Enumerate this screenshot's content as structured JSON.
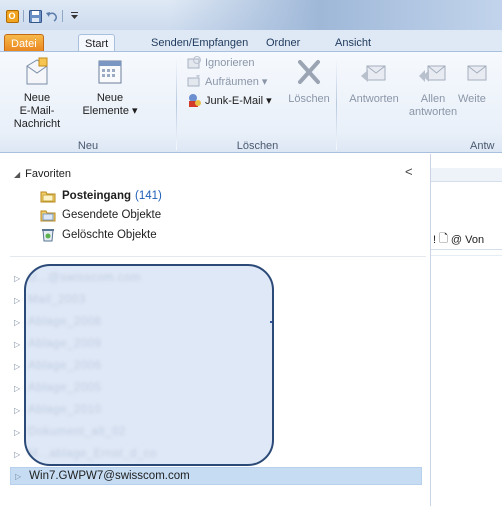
{
  "quick_access": {
    "app_icon_letter": "O",
    "items": [
      "save-icon",
      "undo-icon",
      "customize-icon"
    ]
  },
  "tabs": [
    {
      "label": "Datei",
      "type": "file"
    },
    {
      "label": "Start",
      "type": "active"
    },
    {
      "label": "Senden/Empfangen",
      "type": "normal"
    },
    {
      "label": "Ordner",
      "type": "normal"
    },
    {
      "label": "Ansicht",
      "type": "normal"
    }
  ],
  "ribbon": {
    "neu": {
      "group_label": "Neu",
      "new_email_label": "Neue\nE-Mail-Nachricht",
      "new_items_label": "Neue\nElemente ▾"
    },
    "loeschen": {
      "group_label": "Löschen",
      "ignore_label": "Ignorieren",
      "cleanup_label": "Aufräumen ▾",
      "junk_label": "Junk-E-Mail ▾",
      "delete_label": "Löschen"
    },
    "antworten": {
      "group_label": "Antw",
      "reply_label": "Antworten",
      "reply_all_label": "Allen\nantworten",
      "forward_label": "Weite"
    }
  },
  "navigation": {
    "favorites_header": "Favoriten",
    "collapse_glyph": "<",
    "favorites": [
      {
        "label": "Posteingang",
        "count": "(141)",
        "bold": true,
        "icon": "inbox-icon"
      },
      {
        "label": "Gesendete Objekte",
        "count": "",
        "bold": false,
        "icon": "sent-items-icon"
      },
      {
        "label": "Gelöschte Objekte",
        "count": "",
        "bold": false,
        "icon": "deleted-items-icon"
      }
    ],
    "accounts": [
      {
        "label": "U...@swisscom.com",
        "obscured": true
      },
      {
        "label": "Mail_2003",
        "obscured": true
      },
      {
        "label": "Ablage_2008",
        "obscured": true
      },
      {
        "label": "Ablage_2009",
        "obscured": true
      },
      {
        "label": "Ablage_2006",
        "obscured": true
      },
      {
        "label": "Ablage_2005",
        "obscured": true
      },
      {
        "label": "Ablage_2010",
        "obscured": true
      },
      {
        "label": "Dokument_alt_02",
        "obscured": true
      },
      {
        "label": "M...ablage_Ernst_d_co",
        "obscured": true
      },
      {
        "label": "Win7.GWPW7@swisscom.com",
        "obscured": false,
        "selected": true
      }
    ]
  },
  "message_list": {
    "header_icons": [
      "!",
      "🗋",
      "@"
    ],
    "from_label": "Von"
  },
  "colors": {
    "file_tab": "#e9831d",
    "selection": "#c5dcf3",
    "count_blue": "#1f5fb8",
    "annotation_border": "#2b4a78"
  }
}
